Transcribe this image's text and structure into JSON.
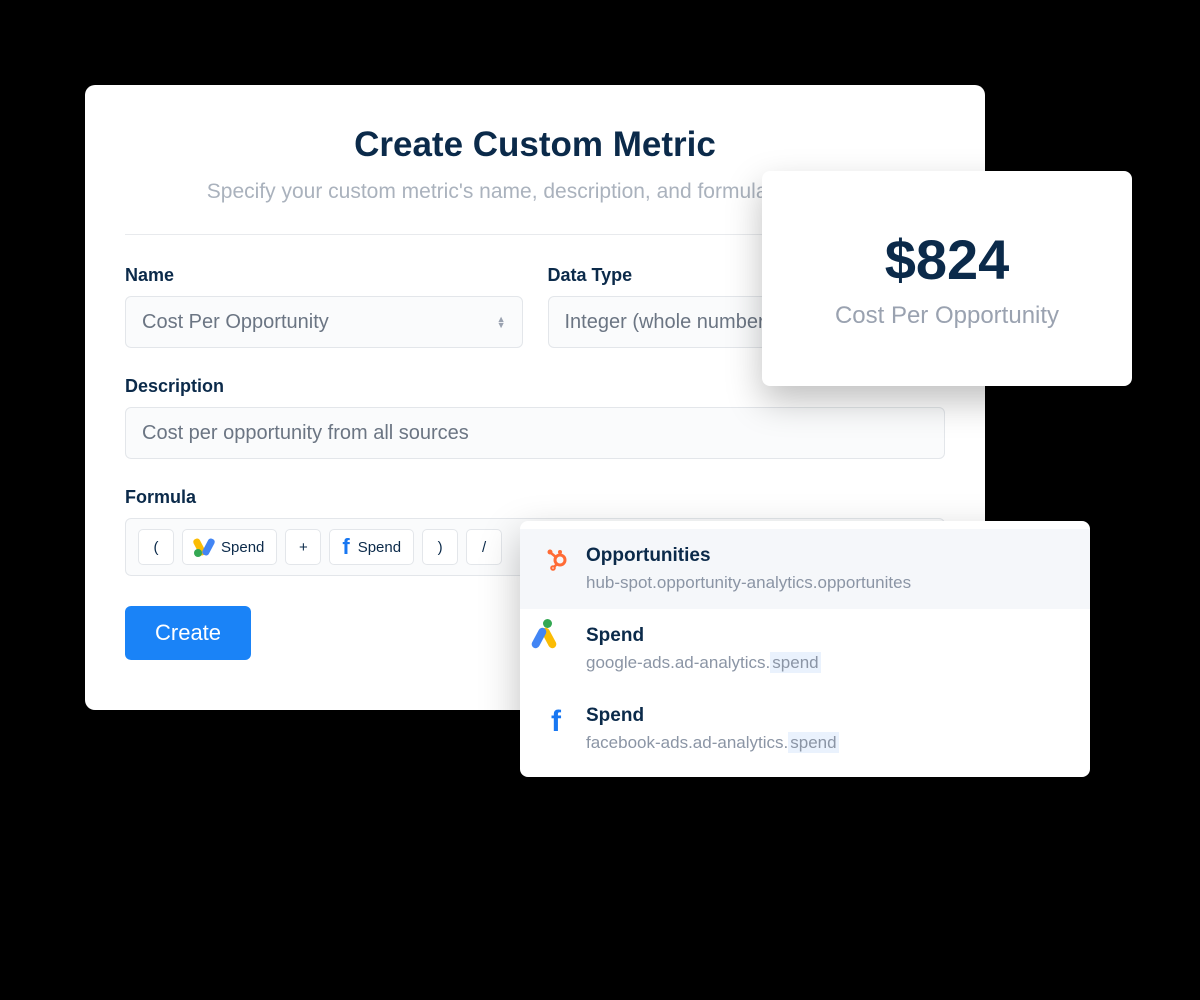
{
  "header": {
    "title": "Create Custom Metric",
    "subtitle": "Specify your custom metric's name, description, and formula to include"
  },
  "form": {
    "name_label": "Name",
    "name_value": "Cost Per Opportunity",
    "data_type_label": "Data Type",
    "data_type_value": "Integer (whole numbers)",
    "description_label": "Description",
    "description_value": "Cost per opportunity from all sources",
    "formula_label": "Formula",
    "formula_tokens": {
      "open_paren": "(",
      "spend_google": "Spend",
      "plus": "+",
      "spend_facebook": "Spend",
      "close_paren": ")",
      "divide": "/"
    },
    "create_button": "Create"
  },
  "stat_card": {
    "value": "$824",
    "label": "Cost Per Opportunity"
  },
  "dropdown": {
    "items": [
      {
        "icon": "hubspot",
        "title": "Opportunities",
        "path": "hub-spot.opportunity-analytics.opportunites",
        "highlight": ""
      },
      {
        "icon": "google-ads",
        "title": "Spend",
        "path_prefix": "google-ads.ad-analytics.",
        "path_highlight": "spend"
      },
      {
        "icon": "facebook",
        "title": "Spend",
        "path_prefix": "facebook-ads.ad-analytics.",
        "path_highlight": "spend"
      }
    ]
  }
}
